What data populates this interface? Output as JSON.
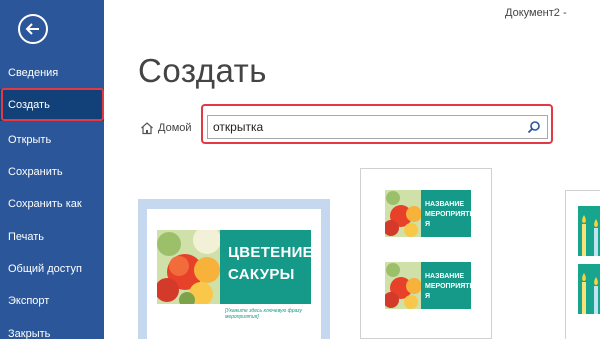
{
  "window": {
    "doc_title": "Документ2 - "
  },
  "page": {
    "title": "Создать"
  },
  "sidebar": {
    "items": [
      {
        "label": "Сведения"
      },
      {
        "label": "Создать"
      },
      {
        "label": "Открыть"
      },
      {
        "label": "Сохранить"
      },
      {
        "label": "Сохранить как"
      },
      {
        "label": "Печать"
      },
      {
        "label": "Общий доступ"
      },
      {
        "label": "Экспорт"
      },
      {
        "label": "Закрыть"
      }
    ]
  },
  "breadcrumb": {
    "home": "Домой"
  },
  "search": {
    "value": "открытка"
  },
  "templates": {
    "card1": {
      "title_line1": "ЦВЕТЕНИЕ",
      "title_line2": "САКУРЫ",
      "subtitle": "[Укажите здесь ключевую фразу мероприятия]"
    },
    "card2": {
      "line1": "НАЗВАНИЕ",
      "line2": "МЕРОПРИЯТИ",
      "line3": "Я"
    }
  },
  "colors": {
    "sidebar": "#2b579a",
    "sidebar_active": "#124078",
    "highlight": "#e23a45",
    "template_green": "#159a8a"
  },
  "icons": {
    "back": "back-arrow-icon",
    "home": "home-icon",
    "search": "search-icon"
  }
}
